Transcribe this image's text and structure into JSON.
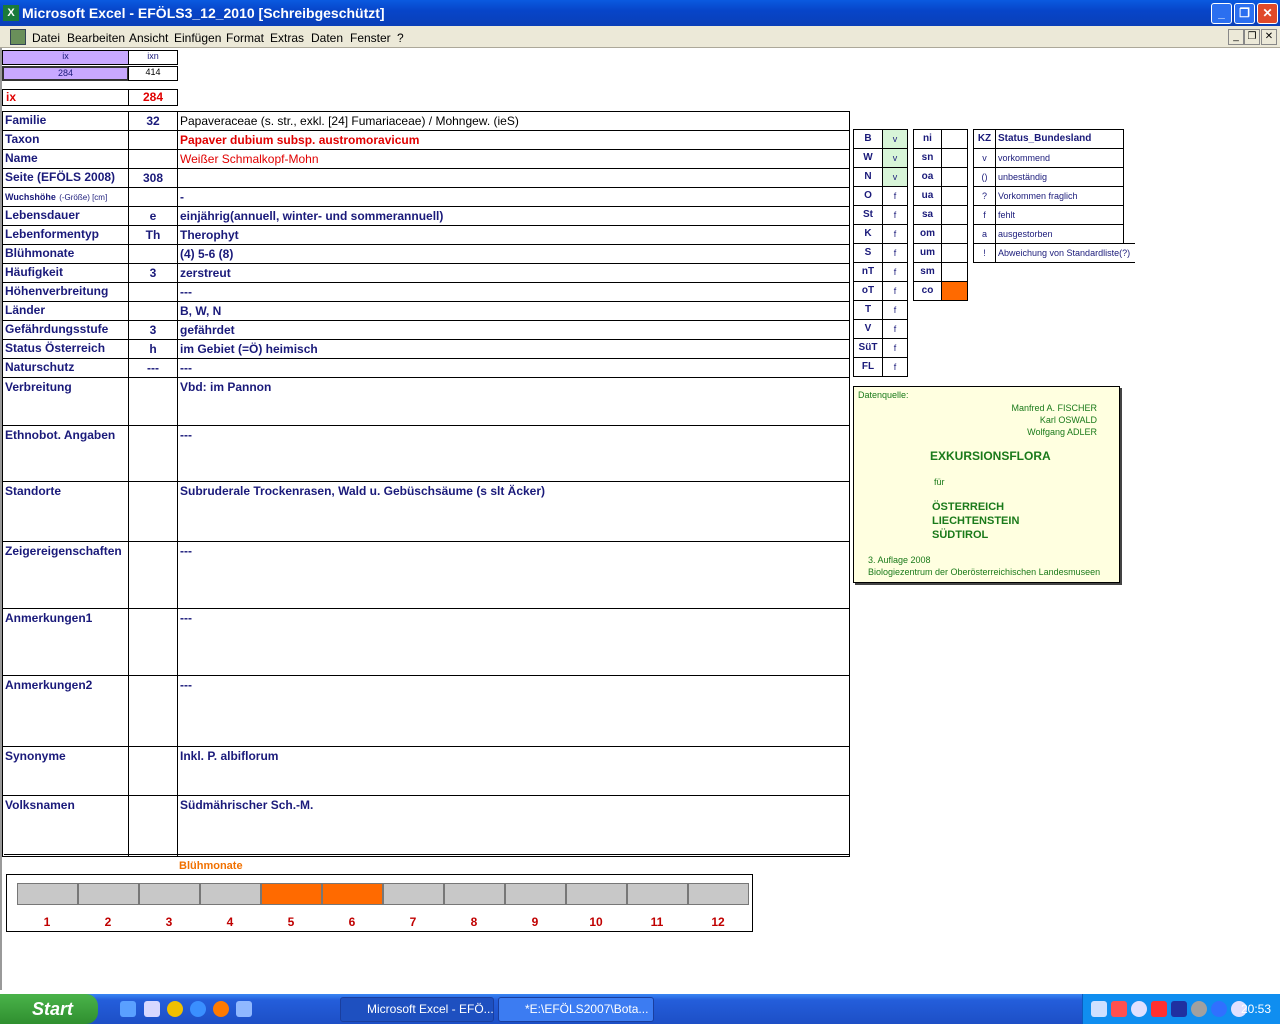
{
  "window": {
    "title": "Microsoft Excel - EFÖLS3_12_2010  [Schreibgeschützt]",
    "app_icon": "X",
    "min": "_",
    "max": "❐",
    "close": "✕"
  },
  "menu": [
    "Datei",
    "Bearbeiten",
    "Ansicht",
    "Einfügen",
    "Format",
    "Extras",
    "Daten",
    "Fenster",
    "?"
  ],
  "menu_ctrl": {
    "min": "_",
    "restore": "❐",
    "close": "✕"
  },
  "top": {
    "ix_label": "ix",
    "ixn_label": "ixn",
    "ix_val": "284",
    "ixn_val": "414",
    "ix2_label": "ix",
    "ix2_val": "284"
  },
  "rows": [
    {
      "label": "Familie",
      "code": "32",
      "text": "Papaveraceae (s. str., exkl. [24] Fumariaceae)  /  Mohngew. (ieS)"
    },
    {
      "label": "Taxon",
      "code": "",
      "text": "Papaver dubium subsp. austromoravicum"
    },
    {
      "label": "Name",
      "code": "",
      "text": "Weißer Schmalkopf-Mohn"
    },
    {
      "label": "Seite (EFÖLS 2008)",
      "code": "308",
      "text": ""
    },
    {
      "label": "Wuchshöhe",
      "label_small": "(-Größe) [cm]",
      "code": "",
      "text": "-"
    },
    {
      "label": "Lebensdauer",
      "code": "e",
      "text": "einjährig(annuell, winter- und sommerannuell)"
    },
    {
      "label": "Lebenformentyp",
      "code": "Th",
      "text": "Therophyt"
    },
    {
      "label": "Blühmonate",
      "code": "",
      "text": "(4) 5-6 (8)"
    },
    {
      "label": "Häufigkeit",
      "code": "3",
      "text": "zerstreut"
    },
    {
      "label": "Höhenverbreitung",
      "code": "",
      "text": "---"
    },
    {
      "label": "Länder",
      "code": "",
      "text": "B, W, N"
    },
    {
      "label": "Gefährdungsstufe",
      "code": "3",
      "text": "gefährdet"
    },
    {
      "label": "Status Österreich",
      "code": "h",
      "text": "im Gebiet (=Ö) heimisch"
    },
    {
      "label": "Naturschutz",
      "code": "---",
      "text": "---"
    },
    {
      "label": "Verbreitung",
      "code": "",
      "text": "Vbd: im Pannon"
    },
    {
      "label": "Ethnobot. Angaben",
      "code": "",
      "text": "---"
    },
    {
      "label": "Standorte",
      "code": "",
      "text": "Subruderale Trockenrasen, Wald u. Gebüschsäume (s slt Äcker)"
    },
    {
      "label": "Zeigereigenschaften",
      "code": "",
      "text": "---"
    },
    {
      "label": "Anmerkungen1",
      "code": "",
      "text": "---"
    },
    {
      "label": "Anmerkungen2",
      "code": "",
      "text": "---"
    },
    {
      "label": "Synonyme",
      "code": "",
      "text": "Inkl. P. albiflorum"
    },
    {
      "label": "Volksnamen",
      "code": "",
      "text": "Südmährischer Sch.-M."
    }
  ],
  "regions1": [
    {
      "code": "B",
      "val": "v",
      "present": true
    },
    {
      "code": "W",
      "val": "v",
      "present": true
    },
    {
      "code": "N",
      "val": "v",
      "present": true
    },
    {
      "code": "O",
      "val": "f",
      "present": false
    },
    {
      "code": "St",
      "val": "f",
      "present": false
    },
    {
      "code": "K",
      "val": "f",
      "present": false
    },
    {
      "code": "S",
      "val": "f",
      "present": false
    },
    {
      "code": "nT",
      "val": "f",
      "present": false
    },
    {
      "code": "oT",
      "val": "f",
      "present": false
    },
    {
      "code": "T",
      "val": "f",
      "present": false
    },
    {
      "code": "V",
      "val": "f",
      "present": false
    },
    {
      "code": "SüT",
      "val": "f",
      "present": false
    },
    {
      "code": "FL",
      "val": "f",
      "present": false
    }
  ],
  "regions2": [
    {
      "code": "ni",
      "val": ""
    },
    {
      "code": "sn",
      "val": ""
    },
    {
      "code": "oa",
      "val": ""
    },
    {
      "code": "ua",
      "val": ""
    },
    {
      "code": "sa",
      "val": ""
    },
    {
      "code": "om",
      "val": ""
    },
    {
      "code": "um",
      "val": ""
    },
    {
      "code": "sm",
      "val": ""
    },
    {
      "code": "co",
      "val": "",
      "highlight": true
    }
  ],
  "status_legend": {
    "kz": "KZ",
    "title": "Status_Bundesland",
    "items": [
      {
        "k": "v",
        "t": "vorkommend"
      },
      {
        "k": "()",
        "t": "unbeständig"
      },
      {
        "k": "?",
        "t": "Vorkommen fraglich"
      },
      {
        "k": "f",
        "t": "fehlt"
      },
      {
        "k": "a",
        "t": "ausgestorben"
      },
      {
        "k": "!",
        "t": "Abweichung von Standardliste(?)"
      }
    ]
  },
  "source": {
    "label": "Datenquelle:",
    "authors": [
      "Manfred A. FISCHER",
      "Karl OSWALD",
      "Wolfgang ADLER"
    ],
    "title": "EXKURSIONSFLORA",
    "fuer": "für",
    "countries": [
      "ÖSTERREICH",
      "LIECHTENSTEIN",
      "SÜDTIROL"
    ],
    "edition": "3. Auflage 2008",
    "publisher": "Biologiezentrum der Oberösterreichischen Landesmuseen"
  },
  "bloom": {
    "title": "Blühmonate",
    "months": [
      "1",
      "2",
      "3",
      "4",
      "5",
      "6",
      "7",
      "8",
      "9",
      "10",
      "11",
      "12"
    ],
    "active": [
      5,
      6
    ],
    "on_color": "#ff6a00",
    "off_color": "#c8c8c8"
  },
  "taskbar": {
    "start": "Start",
    "items": [
      "Microsoft Excel - EFÖ...",
      "*E:\\EFÖLS2007\\Bota..."
    ],
    "time": "20:53"
  }
}
